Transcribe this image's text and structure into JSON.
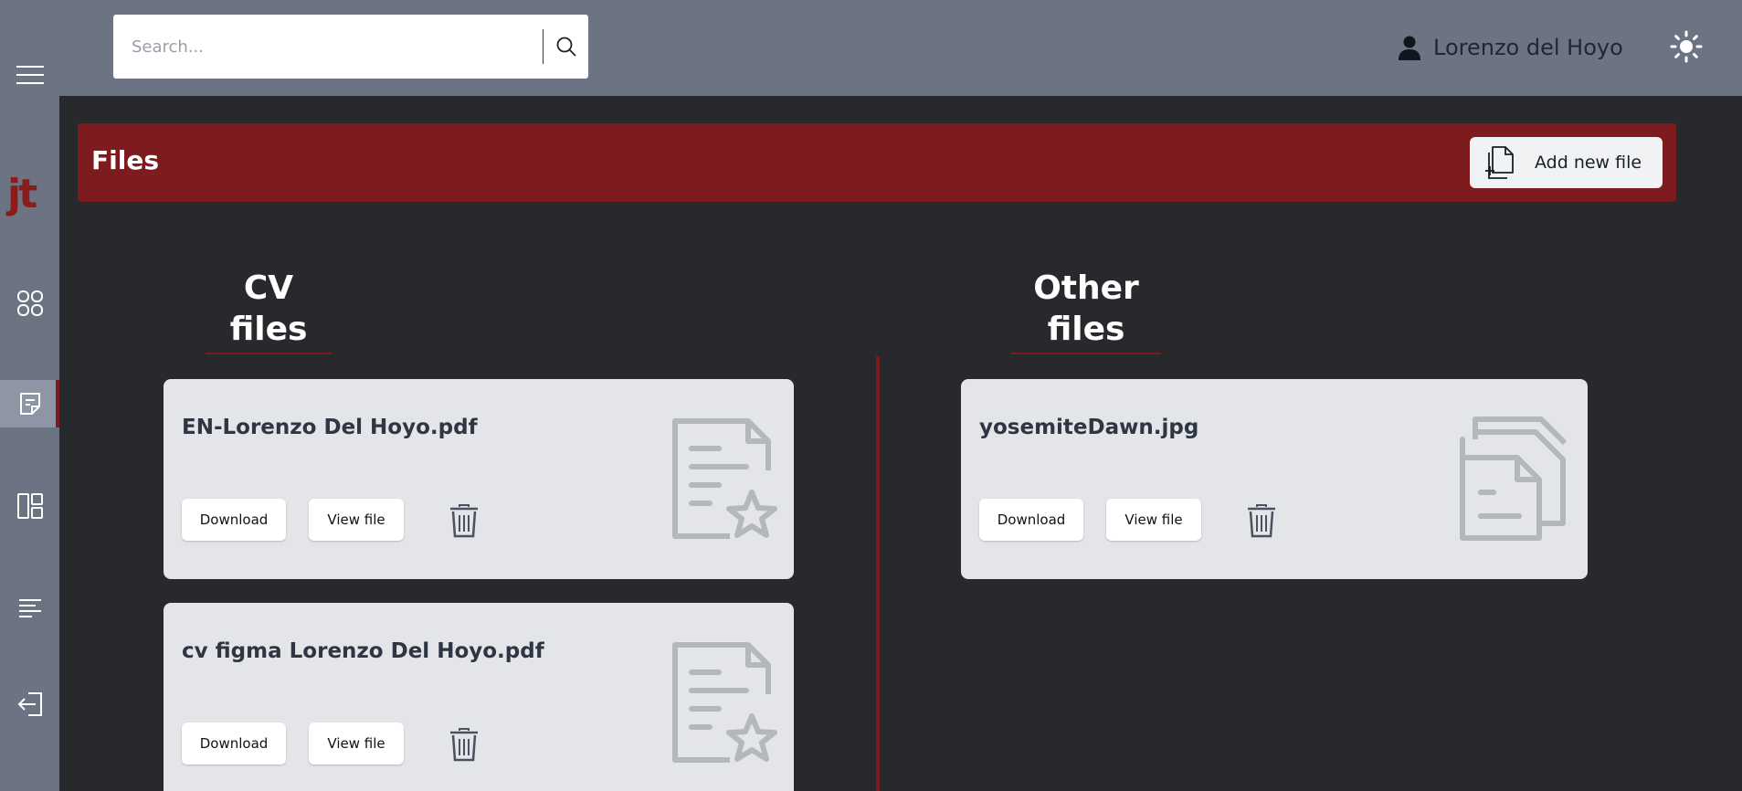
{
  "logo": "jt",
  "search": {
    "placeholder": "Search..."
  },
  "user": {
    "name": "Lorenzo del Hoyo"
  },
  "files_bar": {
    "title": "Files",
    "add_label": "Add new file"
  },
  "sections": {
    "cv": {
      "title_line1": "CV",
      "title_line2": "files"
    },
    "other": {
      "title_line1": "Other",
      "title_line2": "files"
    }
  },
  "cv_files": [
    {
      "name": "EN-Lorenzo Del Hoyo.pdf",
      "download_label": "Download",
      "view_label": "View file"
    },
    {
      "name": "cv figma Lorenzo Del Hoyo.pdf",
      "download_label": "Download",
      "view_label": "View file"
    }
  ],
  "other_files": [
    {
      "name": "yosemiteDawn.jpg",
      "download_label": "Download",
      "view_label": "View file"
    }
  ],
  "colors": {
    "sidebar": "#6c7484",
    "background": "#27292c",
    "accent": "#7e1b1e",
    "card": "#e4e5e8"
  },
  "icons": [
    "menu-icon",
    "dashboard-icon",
    "files-icon",
    "layout-icon",
    "list-icon",
    "logout-icon",
    "search-icon",
    "user-icon",
    "sun-icon",
    "add-file-icon",
    "trash-icon",
    "document-star-icon",
    "documents-icon"
  ]
}
